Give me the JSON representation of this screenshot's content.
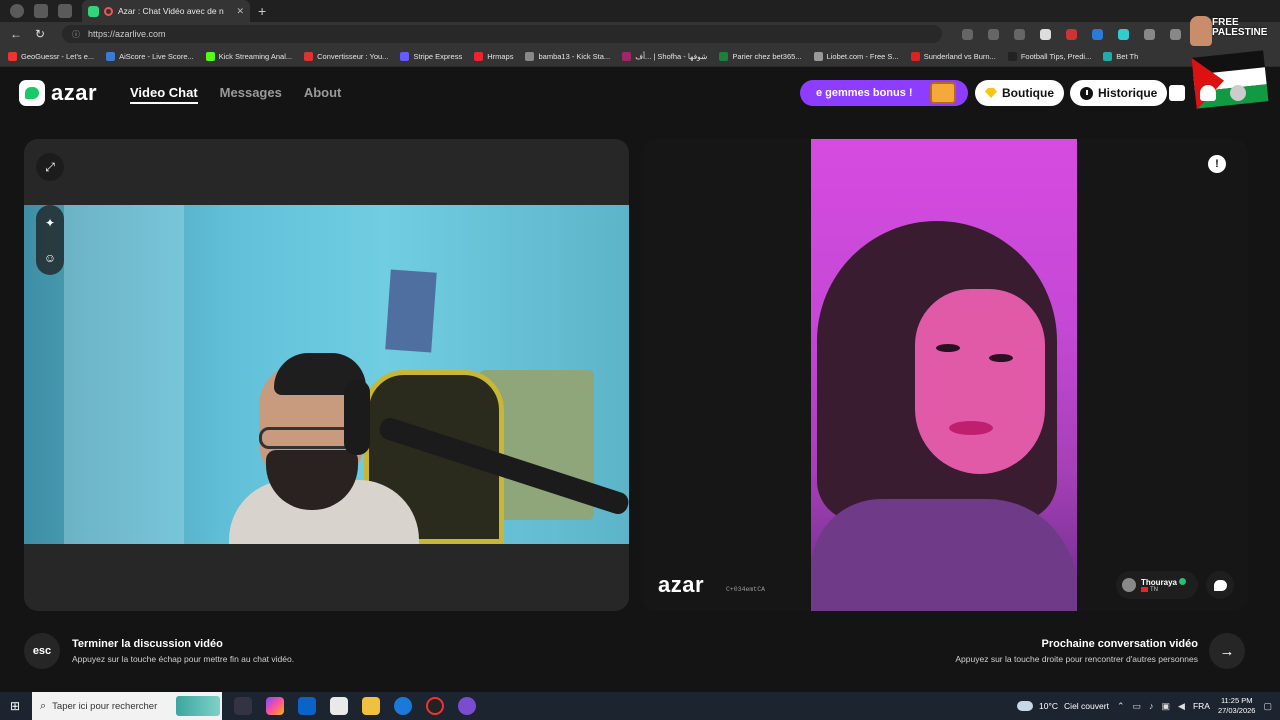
{
  "browser": {
    "tab_title": "Azar : Chat Vidéo avec de n",
    "url": "https://azarlive.com",
    "bookmarks": [
      {
        "label": "GeoGuessr - Let's e...",
        "color": "#e33"
      },
      {
        "label": "AiScore - Live Score...",
        "color": "#3a7bd5"
      },
      {
        "label": "Kick Streaming Anal...",
        "color": "#53fc18"
      },
      {
        "label": "Convertisseur : You...",
        "color": "#d33"
      },
      {
        "label": "Stripe Express",
        "color": "#635bff"
      },
      {
        "label": "Hrmaps",
        "color": "#e23"
      },
      {
        "label": "bamba13 - Kick Sta...",
        "color": "#888"
      },
      {
        "label": "أف... | Shofha - شوفها",
        "color": "#a0266a"
      },
      {
        "label": "Parier chez bet365...",
        "color": "#1d7f3a"
      },
      {
        "label": "Liobet.com - Free S...",
        "color": "#999"
      },
      {
        "label": "Sunderland vs Burn...",
        "color": "#d22"
      },
      {
        "label": "Football Tips, Predi...",
        "color": "#222"
      },
      {
        "label": "Bet Th",
        "color": "#2aa"
      }
    ],
    "overlay_text": "FREE PALESTINE"
  },
  "header": {
    "logo_text": "azar",
    "nav": [
      "Video Chat",
      "Messages",
      "About"
    ],
    "bonus_label": "e gemmes bonus !",
    "shop_label": "Boutique",
    "history_label": "Historique"
  },
  "remote": {
    "watermark": "azar",
    "code": "C+034emtCA",
    "username": "Thouraya",
    "country": "TN"
  },
  "footer": {
    "esc_label": "esc",
    "end_title": "Terminer la discussion vidéo",
    "end_sub": "Appuyez sur la touche échap pour mettre fin au chat vidéo.",
    "next_title": "Prochaine conversation vidéo",
    "next_sub": "Appuyez sur la touche droite pour rencontrer d'autres personnes"
  },
  "taskbar": {
    "search_placeholder": "Taper ici pour rechercher",
    "temperature": "10°C",
    "weather": "Ciel couvert",
    "language": "FRA",
    "time": "11:25 PM",
    "date": "27/03/2026"
  },
  "colors": {
    "brand_green": "#18c964",
    "bonus_purple": "#8c3dff"
  }
}
